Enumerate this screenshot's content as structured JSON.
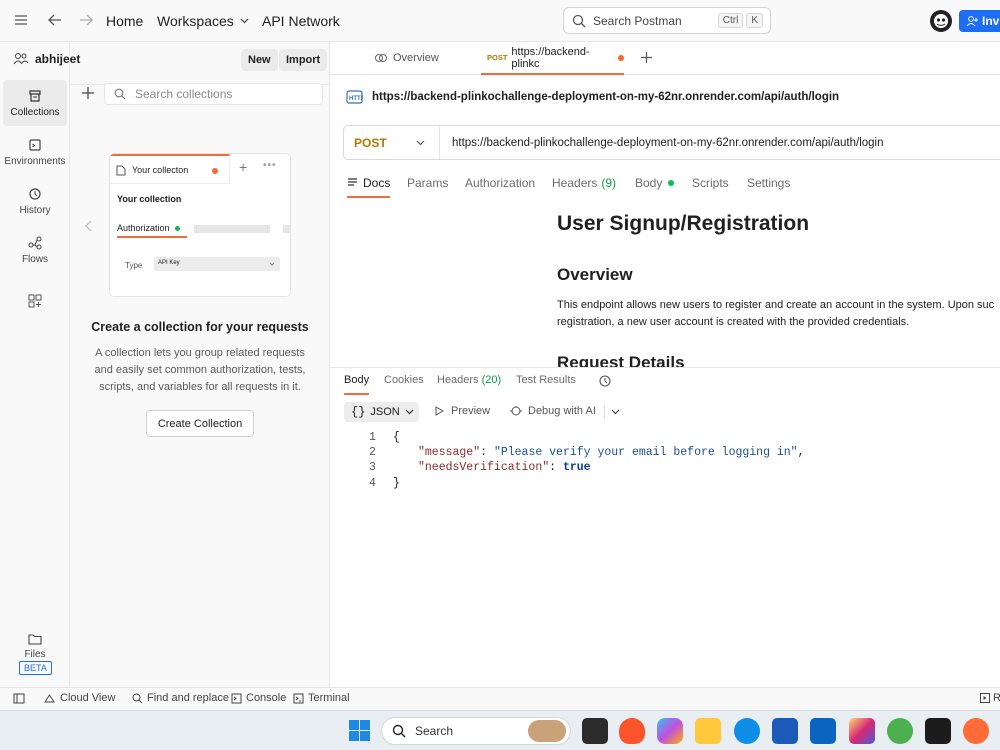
{
  "topbar": {
    "home": "Home",
    "workspaces": "Workspaces",
    "api_network": "API Network",
    "search_placeholder": "Search Postman",
    "shortcut_ctrl": "Ctrl",
    "shortcut_k": "K",
    "invite": "Invit"
  },
  "rail": {
    "items": [
      {
        "label": "Collections"
      },
      {
        "label": "Environments"
      },
      {
        "label": "History"
      },
      {
        "label": "Flows"
      }
    ],
    "files": "Files",
    "beta": "BETA"
  },
  "sidebar": {
    "workspace_name": "abhijeet",
    "new_label": "New",
    "import_label": "Import",
    "search_placeholder": "Search collections",
    "preview": {
      "tab_label": "Your collecton",
      "title": "Your collection",
      "auth_label": "Authorization",
      "type_label": "Type",
      "type_value": "API Key"
    },
    "empty_title": "Create a collection for your requests",
    "empty_desc": "A collection lets you group related requests and easily set common authorization, tests, scripts, and variables for all requests in it.",
    "create_button": "Create Collection"
  },
  "tabs": {
    "overview": "Overview",
    "active_method": "POST",
    "active_label": "https://backend-plinkc"
  },
  "request": {
    "title_url": "https://backend-plinkochallenge-deployment-on-my-62nr.onrender.com/api/auth/login",
    "method": "POST",
    "url": "https://backend-plinkochallenge-deployment-on-my-62nr.onrender.com/api/auth/login",
    "tabs": {
      "docs": "Docs",
      "params": "Params",
      "authorization": "Authorization",
      "headers": "Headers",
      "headers_count": "(9)",
      "body": "Body",
      "scripts": "Scripts",
      "settings": "Settings"
    }
  },
  "docs": {
    "heading": "User Signup/Registration",
    "overview": "Overview",
    "paragraph": "This endpoint allows new users to register and create an account in the system. Upon suc registration, a new user account is created with the provided credentials.",
    "partial_heading": "Request Details"
  },
  "response": {
    "tabs": {
      "body": "Body",
      "cookies": "Cookies",
      "headers": "Headers",
      "headers_count": "(20)",
      "test_results": "Test Results"
    },
    "format": "JSON",
    "preview": "Preview",
    "debug": "Debug with AI",
    "lines": {
      "l1": "1",
      "l2": "2",
      "l3": "3",
      "l4": "4",
      "open": "{",
      "message_key": "\"message\"",
      "message_val": "\"Please verify your email before logging in\"",
      "verify_key": "\"needsVerification\"",
      "verify_val": "true",
      "close": "}"
    }
  },
  "statusbar": {
    "cloud_view": "Cloud View",
    "find_replace": "Find and replace",
    "console": "Console",
    "terminal": "Terminal",
    "right": "R"
  },
  "taskbar": {
    "search": "Search"
  },
  "colors": {
    "accent_orange": "#f26b3a",
    "method_post": "#ad7a03",
    "invite_blue": "#1d6ef4",
    "green": "#0cbb52"
  }
}
